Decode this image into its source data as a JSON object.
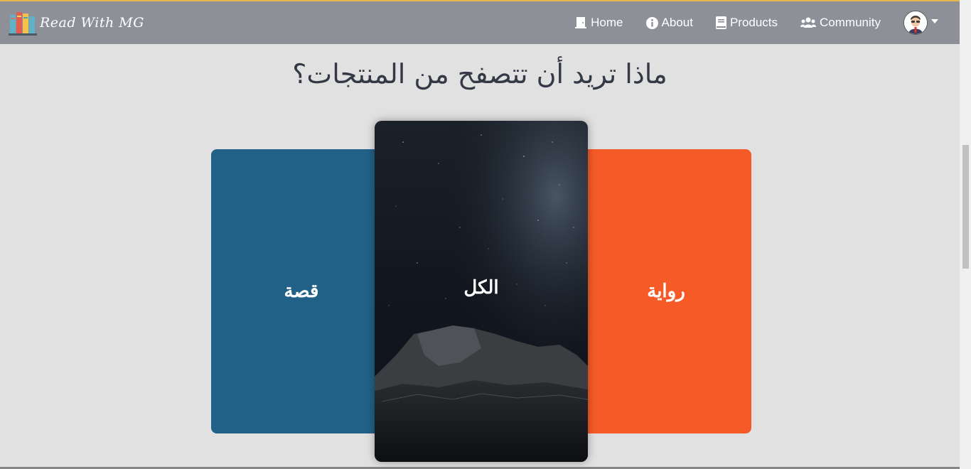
{
  "brand": {
    "name": "Read With MG",
    "logo_icon": "books-icon"
  },
  "nav": {
    "items": [
      {
        "label": "Home",
        "icon": "door-icon"
      },
      {
        "label": "About",
        "icon": "info-icon"
      },
      {
        "label": "Products",
        "icon": "book-icon"
      },
      {
        "label": "Community",
        "icon": "users-icon"
      }
    ],
    "avatar_icon": "user-avatar-icon"
  },
  "main": {
    "heading": "ماذا تريد أن تتصفح من المنتجات؟",
    "cards": {
      "left": "قصة",
      "center": "الكل",
      "right": "رواية"
    }
  },
  "colors": {
    "navbar": "#8e9097",
    "background": "#e2e1e2",
    "card_left": "#216187",
    "card_right": "#f65b27",
    "card_center": "#141820",
    "accent_line": "#e8b94a"
  }
}
